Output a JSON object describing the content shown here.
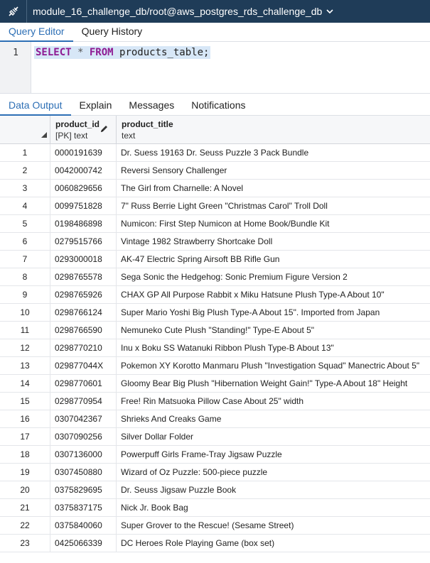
{
  "connection": {
    "label": "module_16_challenge_db/root@aws_postgres_rds_challenge_db",
    "icon": "connection-plug-icon"
  },
  "editor_tabs": [
    {
      "label": "Query Editor",
      "active": true
    },
    {
      "label": "Query History",
      "active": false
    }
  ],
  "editor": {
    "line_number": "1",
    "tokens": {
      "select": "SELECT",
      "star": " * ",
      "from": "FROM",
      "table": " products_table;"
    }
  },
  "output_tabs": [
    {
      "label": "Data Output",
      "active": true
    },
    {
      "label": "Explain",
      "active": false
    },
    {
      "label": "Messages",
      "active": false
    },
    {
      "label": "Notifications",
      "active": false
    }
  ],
  "columns": [
    {
      "name": "product_id",
      "type": "[PK] text"
    },
    {
      "name": "product_title",
      "type": "text"
    }
  ],
  "rows": [
    {
      "n": "1",
      "id": "0000191639",
      "title": "Dr. Suess 19163 Dr. Seuss Puzzle 3 Pack Bundle"
    },
    {
      "n": "2",
      "id": "0042000742",
      "title": "Reversi Sensory Challenger"
    },
    {
      "n": "3",
      "id": "0060829656",
      "title": "The Girl from Charnelle: A Novel"
    },
    {
      "n": "4",
      "id": "0099751828",
      "title": "7\" Russ Berrie Light Green \"Christmas Carol\" Troll Doll"
    },
    {
      "n": "5",
      "id": "0198486898",
      "title": "Numicon: First Step Numicon at Home Book/Bundle Kit"
    },
    {
      "n": "6",
      "id": "0279515766",
      "title": "Vintage 1982 Strawberry Shortcake Doll"
    },
    {
      "n": "7",
      "id": "0293000018",
      "title": "AK-47 Electric Spring Airsoft BB Rifle Gun"
    },
    {
      "n": "8",
      "id": "0298765578",
      "title": "Sega Sonic the Hedgehog: Sonic Premium Figure Version 2"
    },
    {
      "n": "9",
      "id": "0298765926",
      "title": "CHAX GP All Purpose Rabbit x Miku Hatsune Plush Type-A About 10\""
    },
    {
      "n": "10",
      "id": "0298766124",
      "title": "Super Mario Yoshi Big Plush Type-A About 15\". Imported from Japan"
    },
    {
      "n": "11",
      "id": "0298766590",
      "title": "Nemuneko Cute Plush \"Standing!\" Type-E About 5\""
    },
    {
      "n": "12",
      "id": "0298770210",
      "title": "Inu x Boku SS Watanuki Ribbon Plush Type-B About 13\""
    },
    {
      "n": "13",
      "id": "029877044X",
      "title": "Pokemon XY Korotto Manmaru Plush \"Investigation Squad\" Manectric About 5\""
    },
    {
      "n": "14",
      "id": "0298770601",
      "title": "Gloomy Bear Big Plush \"Hibernation Weight Gain!\" Type-A About 18\" Height"
    },
    {
      "n": "15",
      "id": "0298770954",
      "title": "Free! Rin Matsuoka Pillow Case About 25\" width"
    },
    {
      "n": "16",
      "id": "0307042367",
      "title": "Shrieks And Creaks Game"
    },
    {
      "n": "17",
      "id": "0307090256",
      "title": "Silver Dollar Folder"
    },
    {
      "n": "18",
      "id": "0307136000",
      "title": "Powerpuff Girls Frame-Tray Jigsaw Puzzle"
    },
    {
      "n": "19",
      "id": "0307450880",
      "title": "Wizard of Oz Puzzle: 500-piece puzzle"
    },
    {
      "n": "20",
      "id": "0375829695",
      "title": "Dr. Seuss Jigsaw Puzzle Book"
    },
    {
      "n": "21",
      "id": "0375837175",
      "title": "Nick Jr. Book Bag"
    },
    {
      "n": "22",
      "id": "0375840060",
      "title": "Super Grover to the Rescue! (Sesame Street)"
    },
    {
      "n": "23",
      "id": "0425066339",
      "title": "DC Heroes Role Playing Game (box set)"
    }
  ]
}
